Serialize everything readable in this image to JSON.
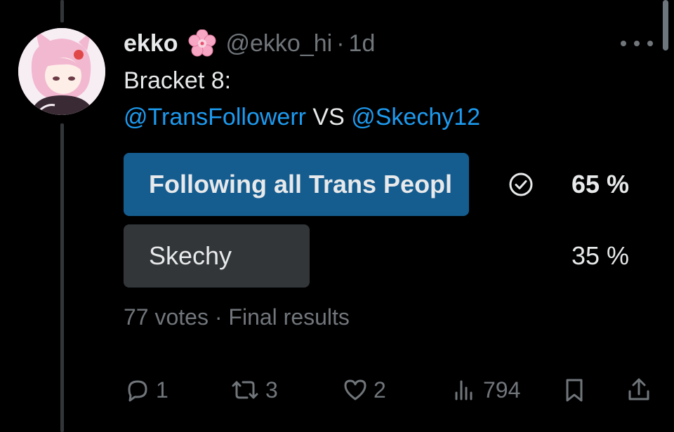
{
  "tweet": {
    "author_name": "ekko",
    "emoji_name": "cherry-blossom-emoji",
    "handle": "@ekko_hi",
    "separator": "·",
    "time": "1d",
    "line1": "Bracket 8:",
    "mention1": "@TransFollowerr",
    "vs": " VS ",
    "mention2": "@Skechy12"
  },
  "poll": {
    "options": [
      {
        "label": "Following all Trans Peopl",
        "percent_text": "65 %",
        "percent": 65,
        "winner": true
      },
      {
        "label": "Skechy",
        "percent_text": "35 %",
        "percent": 35,
        "winner": false
      }
    ],
    "votes": "77 votes",
    "separator": "·",
    "status": "Final results"
  },
  "actions": {
    "replies": "1",
    "reposts": "3",
    "likes": "2",
    "views": "794"
  },
  "colors": {
    "background": "#000000",
    "text": "#e7e9ea",
    "muted": "#71767b",
    "link": "#1d9bf0",
    "winner_bar": "#155c8f",
    "loser_bar": "#333639"
  }
}
